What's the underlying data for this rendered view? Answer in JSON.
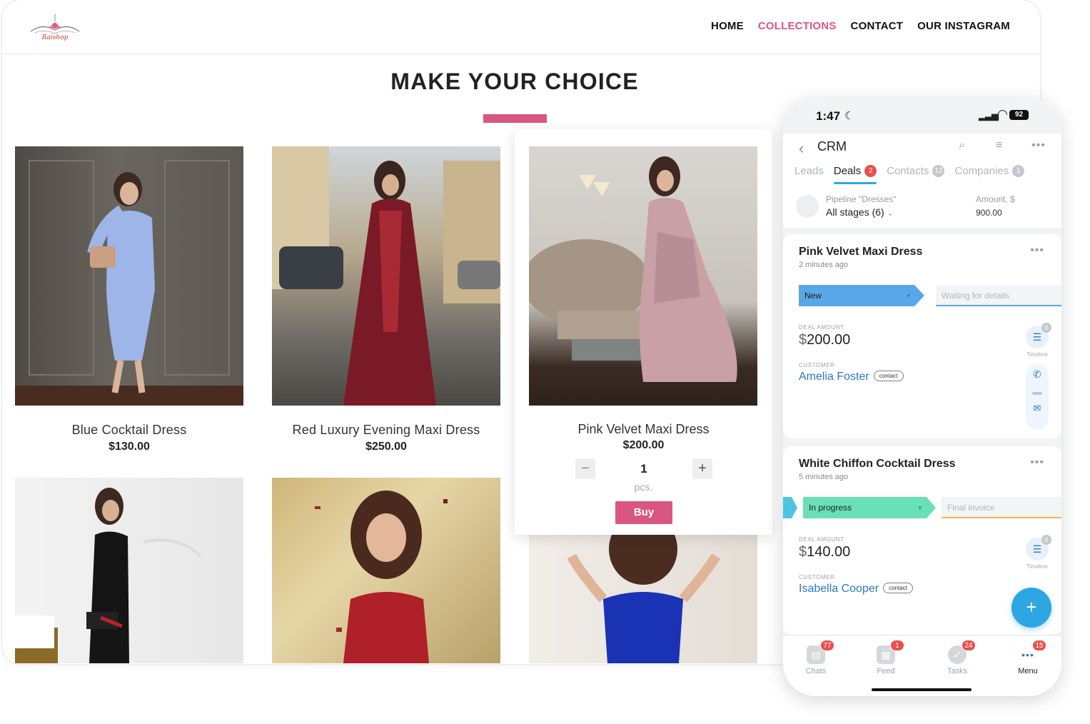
{
  "site": {
    "logo_text": "Raishop",
    "nav": [
      "HOME",
      "COLLECTIONS",
      "CONTACT",
      "OUR INSTAGRAM"
    ],
    "active_nav": "COLLECTIONS",
    "headline": "MAKE YOUR CHOICE",
    "accent_color": "#d9577f",
    "products": [
      {
        "name": "Blue Cocktail Dress",
        "price": "$130.00"
      },
      {
        "name": "Red Luxury Evening Maxi Dress",
        "price": "$250.00"
      },
      {
        "name": "Pink Velvet Maxi Dress",
        "price": "$200.00"
      }
    ],
    "cart": {
      "qty": "1",
      "unit": "pcs.",
      "minus": "−",
      "plus": "+",
      "buy": "Buy"
    }
  },
  "phone": {
    "time": "1:47",
    "battery": "92",
    "app_title": "CRM",
    "tabs": [
      {
        "label": "Leads",
        "count": ""
      },
      {
        "label": "Deals",
        "count": "2"
      },
      {
        "label": "Contacts",
        "count": "12"
      },
      {
        "label": "Companies",
        "count": "1"
      }
    ],
    "pipeline": {
      "label": "Pipeline \"Dresses\"",
      "stages": "All stages (6)",
      "amount_label": "Amount, $",
      "amount": "900.00"
    },
    "deals": [
      {
        "title": "Pink Velvet Maxi Dress",
        "ago": "2 minutes ago",
        "stage": "New",
        "next_stage": "Waiting for details",
        "amount_label": "DEAL AMOUNT",
        "currency": "$",
        "amount": "200.00",
        "customer_label": "CUSTOMER",
        "customer": "Amelia Foster",
        "customer_tag": "contact",
        "timeline_count": "0",
        "timeline_label": "Timeline"
      },
      {
        "title": "White Chiffon Cocktail Dress",
        "ago": "5 minutes ago",
        "stage": "In progress",
        "next_stage": "Final invoice",
        "amount_label": "DEAL AMOUNT",
        "currency": "$",
        "amount": "140.00",
        "customer_label": "CUSTOMER",
        "customer": "Isabella Cooper",
        "customer_tag": "contact",
        "timeline_count": "0",
        "timeline_label": "Timeline"
      }
    ],
    "fab": "+",
    "bottom_tabs": [
      {
        "label": "Chats",
        "count": "77"
      },
      {
        "label": "Feed",
        "count": "1"
      },
      {
        "label": "Tasks",
        "count": "24"
      },
      {
        "label": "Menu",
        "count": "15"
      }
    ]
  }
}
